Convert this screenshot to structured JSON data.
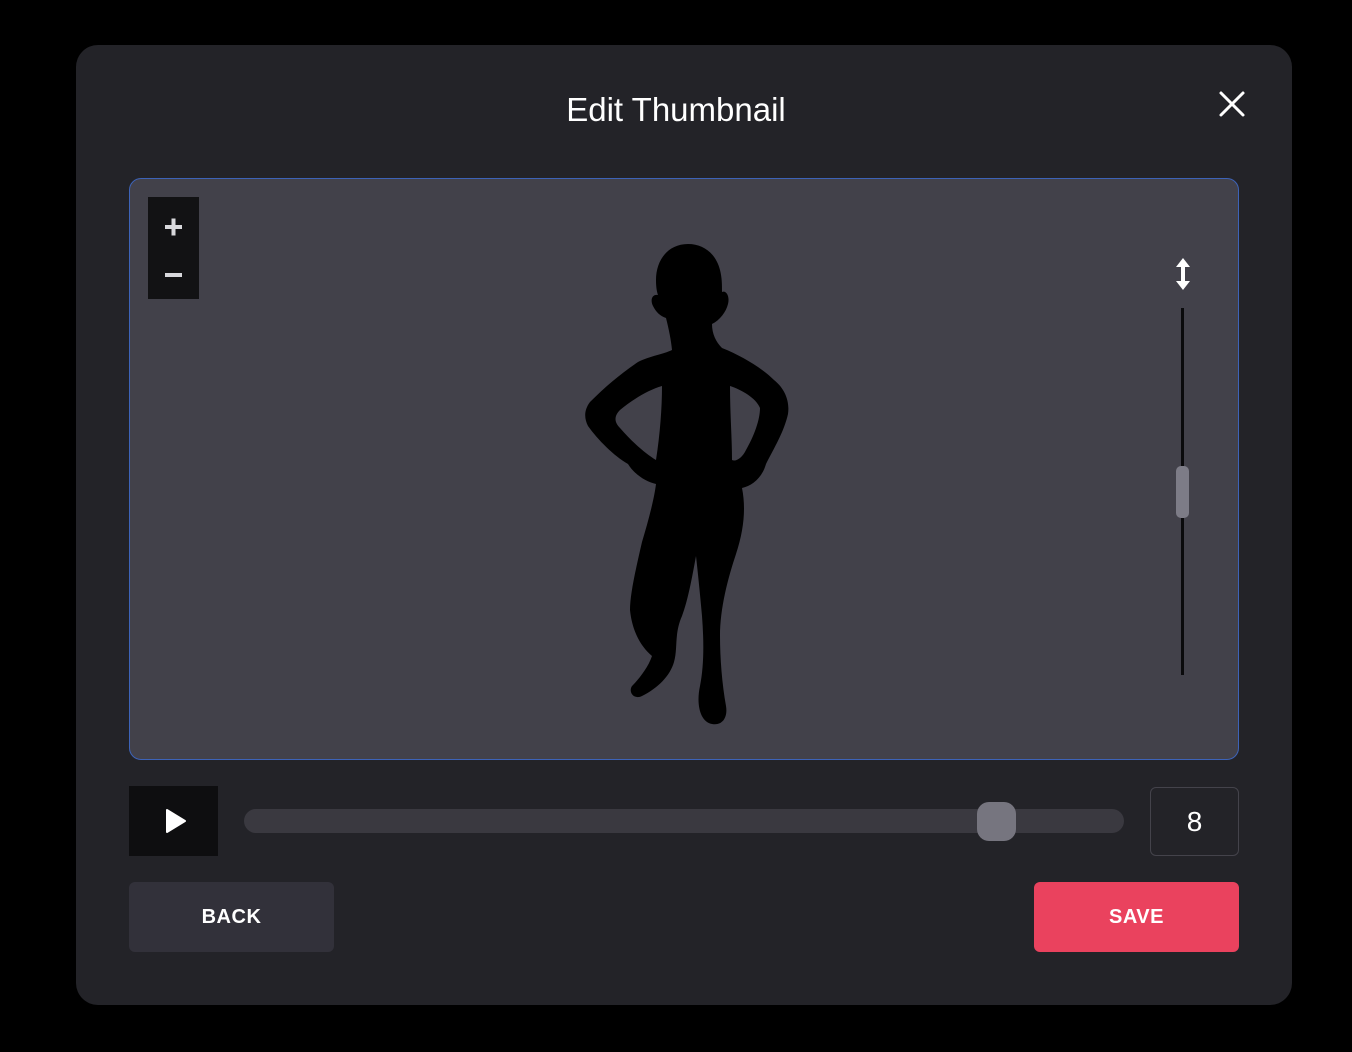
{
  "dialog": {
    "title": "Edit Thumbnail"
  },
  "viewport": {
    "zoom_in_icon": "plus-icon",
    "zoom_out_icon": "minus-icon",
    "height_control_icon": "vertical-resize-arrows-icon",
    "height_level": 0.5
  },
  "playback": {
    "play_icon": "play-icon",
    "timeline_position": 0.85,
    "frame_value": "8"
  },
  "footer": {
    "back_label": "BACK",
    "save_label": "SAVE"
  },
  "colors": {
    "modal_bg": "#232328",
    "viewport_bg": "#42414a",
    "viewport_border": "#3d63b8",
    "save_accent": "#ea425e",
    "back_bg": "#32313a"
  }
}
